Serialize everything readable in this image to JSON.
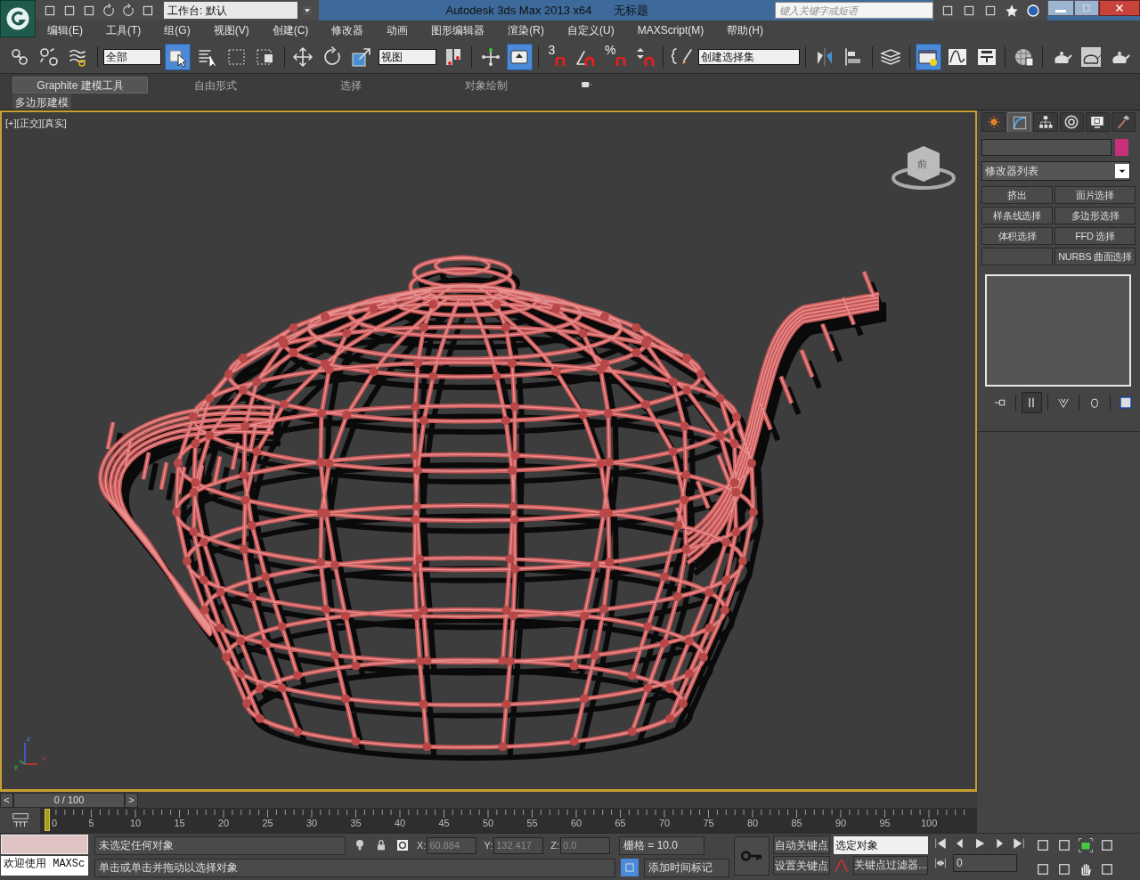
{
  "title_bar": {
    "workspace": "工作台: 默认",
    "title": "Autodesk 3ds Max  2013 x64",
    "document": "无标题",
    "search": {
      "placeholder": "键入关键字或短语"
    }
  },
  "menu": [
    "编辑(E)",
    "工具(T)",
    "组(G)",
    "视图(V)",
    "创建(C)",
    "修改器",
    "动画",
    "图形编辑器",
    "渲染(R)",
    "自定义(U)",
    "MAXScript(M)",
    "帮助(H)"
  ],
  "toolbar": {
    "items": [
      {
        "kind": "icon",
        "selected": false
      },
      {
        "kind": "icon",
        "selected": false
      },
      {
        "kind": "icon",
        "selected": false
      },
      {
        "kind": "separator"
      },
      {
        "kind": "dropdown",
        "value": "全部"
      },
      {
        "kind": "icon",
        "selected": true
      },
      {
        "kind": "icon",
        "selected": false
      },
      {
        "kind": "icon",
        "selected": false
      },
      {
        "kind": "icon",
        "selected": false
      },
      {
        "kind": "separator"
      },
      {
        "kind": "icon",
        "selected": false
      },
      {
        "kind": "icon",
        "selected": false
      },
      {
        "kind": "icon",
        "selected": false
      },
      {
        "kind": "dropdown",
        "value": "视图"
      },
      {
        "kind": "icon",
        "selected": false
      },
      {
        "kind": "separator"
      },
      {
        "kind": "icon",
        "selected": false
      },
      {
        "kind": "icon",
        "selected": true
      },
      {
        "kind": "separator"
      },
      {
        "kind": "labeled",
        "label": "3",
        "selected": false
      },
      {
        "kind": "icon",
        "selected": false
      },
      {
        "kind": "labeled",
        "label": "%",
        "selected": false
      },
      {
        "kind": "icon",
        "selected": false
      },
      {
        "kind": "separator"
      },
      {
        "kind": "icon",
        "selected": false
      },
      {
        "kind": "dropdown",
        "value": "创建选择集"
      },
      {
        "kind": "separator"
      },
      {
        "kind": "icon",
        "selected": false
      },
      {
        "kind": "icon",
        "selected": false
      },
      {
        "kind": "separator"
      },
      {
        "kind": "icon",
        "selected": false
      },
      {
        "kind": "separator"
      },
      {
        "kind": "icon",
        "selected": true
      },
      {
        "kind": "icon",
        "selected": false
      },
      {
        "kind": "icon",
        "selected": false
      },
      {
        "kind": "separator"
      },
      {
        "kind": "icon",
        "selected": false
      },
      {
        "kind": "separator"
      },
      {
        "kind": "icon",
        "selected": false
      },
      {
        "kind": "icon",
        "selected": false
      },
      {
        "kind": "icon",
        "selected": false
      }
    ]
  },
  "ribbon": {
    "tabs": [
      {
        "label": "Graphite 建模工具",
        "selected": true
      },
      {
        "label": "自由形式",
        "selected": false
      },
      {
        "label": "选择",
        "selected": false
      },
      {
        "label": "对象绘制",
        "selected": false
      }
    ],
    "panel": "多边形建模"
  },
  "viewport": {
    "label_parts": [
      "[+]",
      "[正交]",
      "[真实]"
    ],
    "active": true,
    "viewcube": "前",
    "axes": [
      "z",
      "x",
      "y"
    ]
  },
  "command_panel": {
    "tabs": [
      {
        "selected": false
      },
      {
        "selected": true
      },
      {
        "selected": false
      },
      {
        "selected": false
      },
      {
        "selected": false
      },
      {
        "selected": false
      }
    ],
    "modifier_list": "修改器列表",
    "modifier_buttons": [
      {
        "kind": "button",
        "label": "挤出"
      },
      {
        "kind": "button",
        "label": "面片选择"
      },
      {
        "kind": "button",
        "label": "样条线选择"
      },
      {
        "kind": "button",
        "label": "多边形选择"
      },
      {
        "kind": "button",
        "label": "体积选择"
      },
      {
        "kind": "button",
        "label": "FFD 选择"
      },
      {
        "kind": "blank"
      },
      {
        "kind": "button",
        "label": "NURBS 曲面选择"
      }
    ],
    "stack_tools": [
      {
        "selected": false
      },
      {
        "selected": true
      },
      {
        "selected": false
      },
      {
        "selected": false
      },
      {
        "selected": false
      }
    ]
  },
  "time_slider": {
    "prev": "<",
    "position": "0 / 100",
    "next": ">",
    "level": 0
  },
  "track_bar": {
    "ticks": [
      "0",
      "5",
      "10",
      "15",
      "20",
      "25",
      "30",
      "35",
      "40",
      "45",
      "50",
      "55",
      "60",
      "65",
      "70",
      "75",
      "80",
      "85",
      "90",
      "95",
      "100"
    ]
  },
  "status": {
    "listener_output": "欢迎使用 MAXSc",
    "selection": "未选定任何对象",
    "prompt": "单击或单击并拖动以选择对象",
    "coordinates": [
      {
        "label": "X:",
        "value": "60.884",
        "disabled": true
      },
      {
        "label": "Y:",
        "value": "132.417",
        "disabled": true
      },
      {
        "label": "Z:",
        "value": "0.0",
        "disabled": true
      }
    ],
    "grid": "栅格 = 10.0",
    "time_tag": "添加时间标记",
    "auto_key": "自动关键点",
    "set_key": "设置关键点",
    "key_mode": "选定对象",
    "key_filters": "关键点过滤器...",
    "frame": "0"
  }
}
